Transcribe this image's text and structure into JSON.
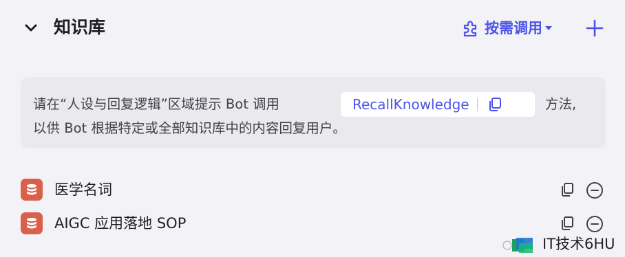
{
  "panel": {
    "title": "知识库",
    "mode_label": "按需调用",
    "icons": {
      "collapse": "chevron-down-icon",
      "mode": "plugin-icon",
      "caret": "caret-down-icon",
      "add": "plus-icon"
    },
    "colors": {
      "accent": "#4d53e8",
      "db_icon_bg": "#d9614c",
      "hint_bg": "#e9e9ee",
      "page_bg": "#f3f3f7"
    }
  },
  "hint": {
    "line1_prefix": "请在“人设与回复逻辑”区域提示 Bot 调用",
    "method_name": "RecallKnowledge",
    "line1_suffix": "方法,",
    "line2": "以供 Bot 根据特定或全部知识库中的内容回复用户。",
    "copy_icon": "copy-icon"
  },
  "knowledge_bases": [
    {
      "name": "医学名词",
      "icon": "database-icon"
    },
    {
      "name": "AIGC 应用落地 SOP",
      "icon": "database-icon"
    }
  ],
  "watermark": {
    "text": "IT技术6HU"
  }
}
